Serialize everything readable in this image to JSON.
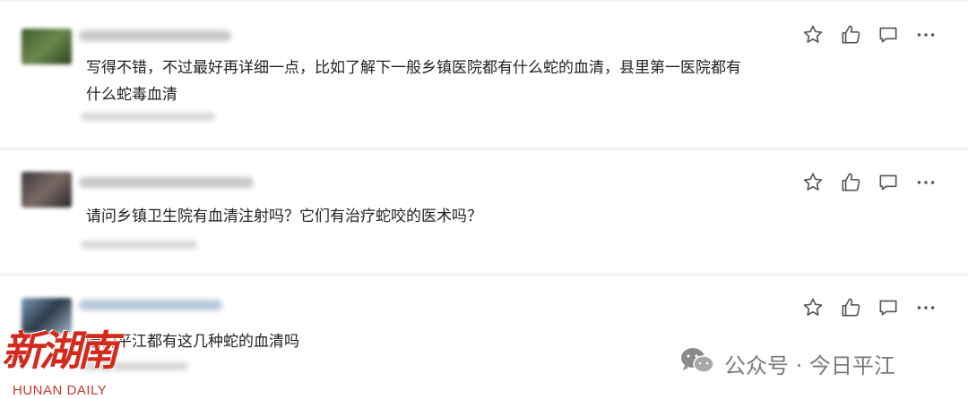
{
  "comments": [
    {
      "text_line1": "写得不错，不过最好再详细一点，比如了解下一般乡镇医院都有什么蛇的血清，县里第一医院都有",
      "text_line2": "什么蛇毒血清"
    },
    {
      "text_line1": "请问乡镇卫生院有血清注射吗？它们有治疗蛇咬的医术吗？"
    },
    {
      "text_line1": "咱们平江都有这几种蛇的血清吗"
    }
  ],
  "actions": [
    "star-icon",
    "thumbs-up-icon",
    "comment-icon",
    "more-icon"
  ],
  "logo": {
    "title": "新湖南",
    "subtitle": "HUNAN DAILY"
  },
  "watermark": {
    "text": "公众号 · 今日平江"
  },
  "colors": {
    "logo_red": "#d42a1e",
    "watermark": "#7a7a7a",
    "icon": "#555555"
  }
}
